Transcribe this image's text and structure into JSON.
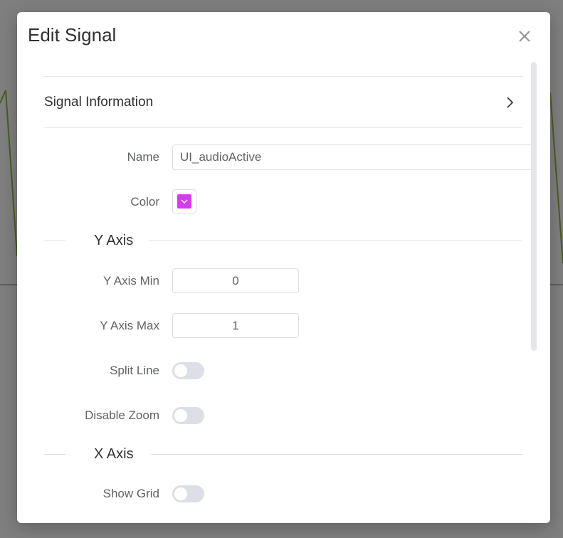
{
  "dialog": {
    "title": "Edit Signal"
  },
  "signal_info": {
    "title": "Signal Information",
    "expanded": false
  },
  "form": {
    "name_label": "Name",
    "name_value": "UI_audioActive",
    "color_label": "Color",
    "color_value": "#d63bf0"
  },
  "y_axis": {
    "section_title": "Y Axis",
    "min_label": "Y Axis Min",
    "min_value": "0",
    "max_label": "Y Axis Max",
    "max_value": "1",
    "split_line_label": "Split Line",
    "split_line_on": false,
    "disable_zoom_label": "Disable Zoom",
    "disable_zoom_on": false
  },
  "x_axis": {
    "section_title": "X Axis",
    "show_grid_label": "Show Grid",
    "show_grid_on": false
  },
  "colors": {
    "backdrop": "#7f7f7f",
    "background_signal_line": "#4a5d23",
    "switch_off": "#dcdfe6"
  }
}
